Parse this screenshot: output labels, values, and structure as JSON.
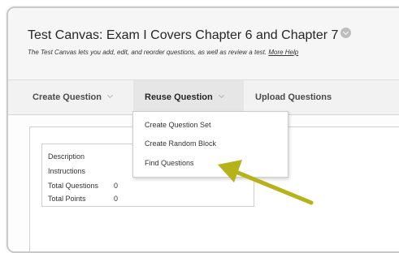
{
  "header": {
    "title": "Test Canvas: Exam I Covers Chapter 6 and Chapter 7",
    "subtitle": "The Test Canvas lets you add, edit, and reorder questions, as well as review a test.",
    "more_help_label": "More Help"
  },
  "toolbar": {
    "create_question_label": "Create Question",
    "reuse_question_label": "Reuse Question",
    "upload_questions_label": "Upload Questions"
  },
  "reuse_menu": {
    "items": [
      {
        "label": "Create Question Set"
      },
      {
        "label": "Create Random Block"
      },
      {
        "label": "Find Questions"
      }
    ]
  },
  "test_info": {
    "rows": [
      {
        "label": "Description",
        "value": ""
      },
      {
        "label": "Instructions",
        "value": ""
      },
      {
        "label": "Total Questions",
        "value": "0"
      },
      {
        "label": "Total Points",
        "value": "0"
      }
    ]
  },
  "annotation": {
    "arrow_color": "#b5b21a"
  }
}
